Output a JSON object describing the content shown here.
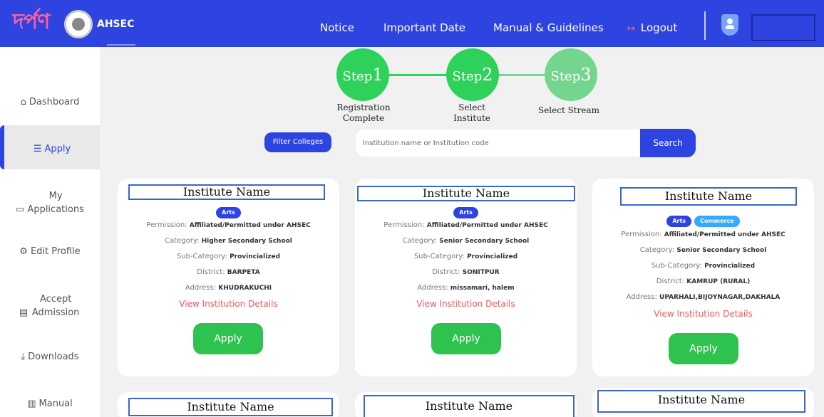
{
  "header": {
    "logo_text": "দৰ্পণ",
    "brand": "AHSEC",
    "nav": {
      "notice": "Notice",
      "important_date": "Important Date",
      "manual": "Manual & Guidelines"
    },
    "logout": "Logout"
  },
  "sidebar": {
    "items": [
      {
        "icon": "⌂",
        "label": "Dashboard"
      },
      {
        "icon": "☰",
        "label": "Apply"
      },
      {
        "icon": "▭",
        "label": "My Applications"
      },
      {
        "icon": "⚙",
        "label": "Edit Profile"
      },
      {
        "icon": "▤",
        "label": "Accept Admission"
      },
      {
        "icon": "⤓",
        "label": "Downloads"
      },
      {
        "icon": "▥",
        "label": "Manual"
      }
    ]
  },
  "steps": [
    {
      "word": "Step",
      "num": "1",
      "caption_line1": "Registration",
      "caption_line2": "Complete"
    },
    {
      "word": "Step",
      "num": "2",
      "caption_line1": "Select",
      "caption_line2": "Institute"
    },
    {
      "word": "Step",
      "num": "3",
      "caption_line1": "Select Stream",
      "caption_line2": ""
    }
  ],
  "filter": {
    "label": "Filter Colleges"
  },
  "search": {
    "placeholder": "Institution name or Institution code",
    "value": "",
    "button": "Search"
  },
  "labels": {
    "permission": "Permission:",
    "category": "Category:",
    "sub_category": "Sub-Category:",
    "district": "District:",
    "address": "Address:",
    "view": "View Institution Details",
    "apply": "Apply"
  },
  "cards": [
    {
      "title": "Institute Name",
      "tags": [
        "Arts"
      ],
      "permission": "Affiliated/Permitted under AHSEC",
      "category": "Higher Secondary School",
      "sub_category": "Provincialized",
      "district": "BARPETA",
      "address": "KHUDRAKUCHI"
    },
    {
      "title": "Institute Name",
      "tags": [
        "Arts"
      ],
      "permission": "Affiliated/Permitted under AHSEC",
      "category": "Senior Secondary School",
      "sub_category": "Provincialized",
      "district": "SONITPUR",
      "address": "missamari, halem"
    },
    {
      "title": "Institute Name",
      "tags": [
        "Arts",
        "Commerce"
      ],
      "permission": "Affiliated/Permitted under AHSEC",
      "category": "Senior Secondary School",
      "sub_category": "Provincialized",
      "district": "KAMRUP (RURAL)",
      "address": "UPARHALI,BIJOYNAGAR,DAKHALA"
    },
    {
      "title": "Institute Name"
    },
    {
      "title": "Institute Name"
    },
    {
      "title": "Institute Name"
    }
  ],
  "colors": {
    "primary": "#2e44e0",
    "success": "#2ec24f",
    "link": "#f05a5a",
    "step": "#2ed15a"
  }
}
